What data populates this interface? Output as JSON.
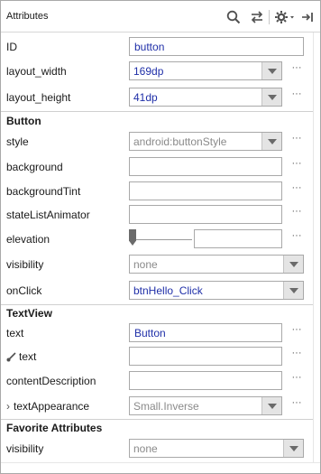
{
  "header": {
    "title": "Attributes",
    "icons": [
      "search-icon",
      "swap-icon",
      "gear-icon",
      "dock-icon"
    ]
  },
  "rows": {
    "id": {
      "label": "ID",
      "value": "button"
    },
    "layout_width": {
      "label": "layout_width",
      "value": "169dp"
    },
    "layout_height": {
      "label": "layout_height",
      "value": "41dp"
    },
    "section_button": "Button",
    "style": {
      "label": "style",
      "value": "android:buttonStyle"
    },
    "background": {
      "label": "background",
      "value": ""
    },
    "backgroundTint": {
      "label": "backgroundTint",
      "value": ""
    },
    "stateListAnimator": {
      "label": "stateListAnimator",
      "value": ""
    },
    "elevation": {
      "label": "elevation",
      "value": ""
    },
    "visibility": {
      "label": "visibility",
      "value": "none"
    },
    "onClick": {
      "label": "onClick",
      "value": "btnHello_Click"
    },
    "section_textview": "TextView",
    "text": {
      "label": "text",
      "value": "Button"
    },
    "text_tools": {
      "label": "text",
      "value": ""
    },
    "contentDescription": {
      "label": "contentDescription",
      "value": ""
    },
    "textAppearance": {
      "label": "textAppearance",
      "value": "Small.Inverse"
    },
    "section_favorite": "Favorite Attributes",
    "fav_visibility": {
      "label": "visibility",
      "value": "none"
    }
  },
  "more_label": "···",
  "colors": {
    "value_blue": "#1f2fa8",
    "placeholder_gray": "#8a8a8a",
    "border": "#a9a9a9"
  }
}
